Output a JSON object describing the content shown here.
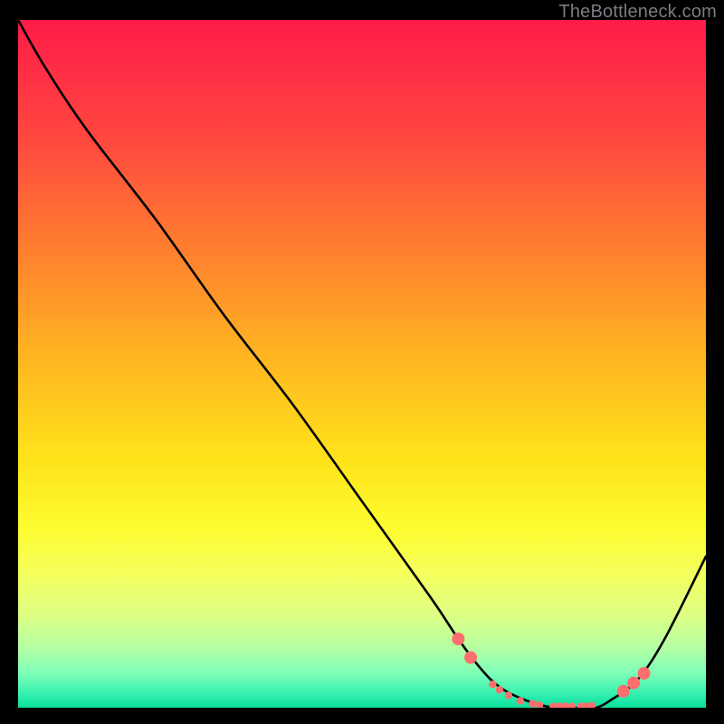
{
  "watermark": "TheBottleneck.com",
  "chart_data": {
    "type": "line",
    "title": "",
    "xlabel": "",
    "ylabel": "",
    "xlim": [
      0,
      100
    ],
    "ylim": [
      0,
      100
    ],
    "grid": false,
    "legend": false,
    "series": [
      {
        "name": "bottleneck-curve",
        "color": "#000000",
        "x": [
          0,
          4,
          10,
          20,
          30,
          40,
          50,
          60,
          64,
          67,
          70,
          74,
          78,
          82,
          84,
          86,
          90,
          94,
          100
        ],
        "y": [
          100,
          93,
          84,
          71,
          57,
          44,
          30,
          16,
          10,
          6,
          3,
          1,
          0,
          0,
          0,
          1,
          4,
          10,
          22
        ]
      }
    ],
    "markers": {
      "name": "highlighted-points",
      "color": "#ff6e6e",
      "radius_large": 7,
      "radius_small": 4.2,
      "points": [
        {
          "x": 64.0,
          "y": 10.0,
          "r": "large"
        },
        {
          "x": 65.8,
          "y": 7.3,
          "r": "large"
        },
        {
          "x": 69.0,
          "y": 3.4,
          "r": "small"
        },
        {
          "x": 70.0,
          "y": 2.6,
          "r": "small"
        },
        {
          "x": 71.3,
          "y": 1.8,
          "r": "small"
        },
        {
          "x": 73.0,
          "y": 1.0,
          "r": "small"
        },
        {
          "x": 74.8,
          "y": 0.6,
          "r": "small"
        },
        {
          "x": 75.8,
          "y": 0.4,
          "r": "small"
        },
        {
          "x": 77.8,
          "y": 0.2,
          "r": "small"
        },
        {
          "x": 78.7,
          "y": 0.2,
          "r": "small"
        },
        {
          "x": 79.5,
          "y": 0.2,
          "r": "small"
        },
        {
          "x": 80.5,
          "y": 0.2,
          "r": "small"
        },
        {
          "x": 81.8,
          "y": 0.2,
          "r": "small"
        },
        {
          "x": 82.6,
          "y": 0.2,
          "r": "small"
        },
        {
          "x": 83.4,
          "y": 0.3,
          "r": "small"
        },
        {
          "x": 88.0,
          "y": 2.4,
          "r": "large"
        },
        {
          "x": 89.5,
          "y": 3.6,
          "r": "large"
        },
        {
          "x": 91.0,
          "y": 5.0,
          "r": "large"
        }
      ]
    }
  }
}
